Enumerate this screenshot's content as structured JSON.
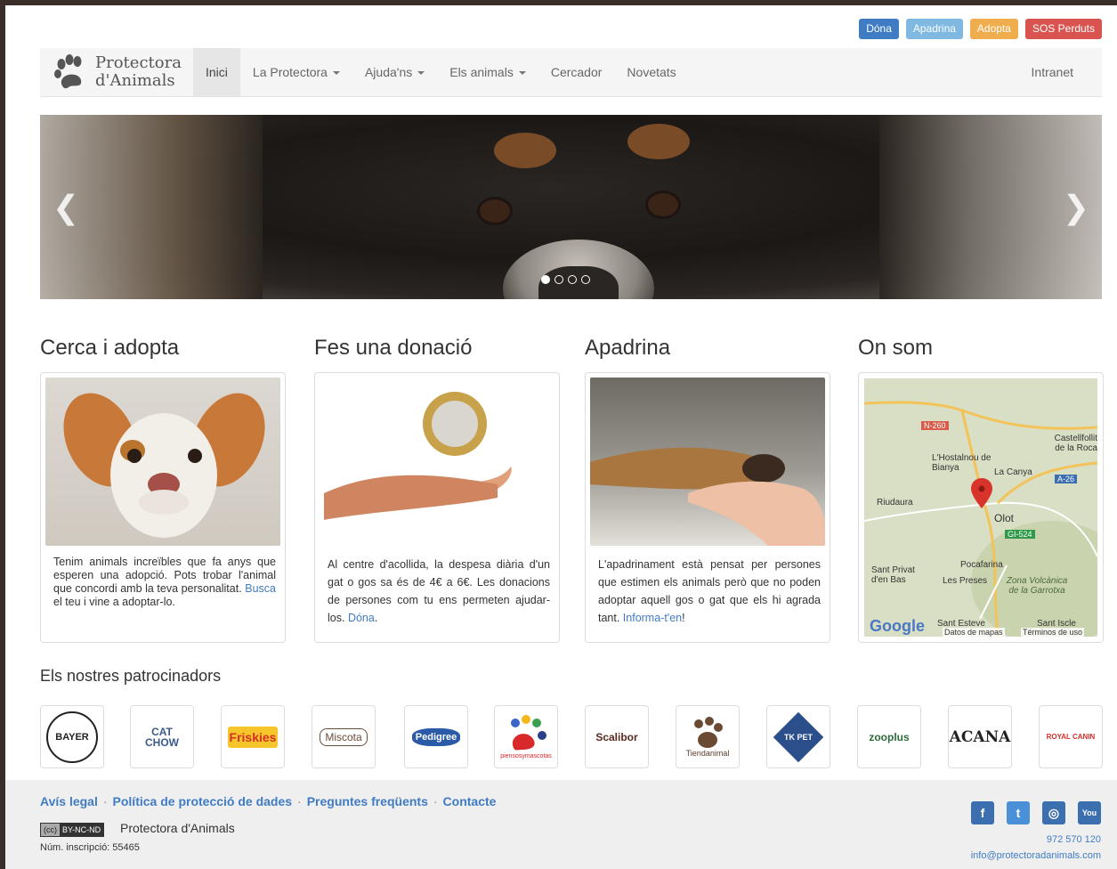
{
  "top_actions": [
    {
      "label": "Dóna",
      "style": "primary"
    },
    {
      "label": "Apadrina",
      "style": "info"
    },
    {
      "label": "Adopta",
      "style": "warning"
    },
    {
      "label": "SOS Perduts",
      "style": "danger"
    }
  ],
  "brand": {
    "line1": "Protectora",
    "line2": "d'Animals"
  },
  "nav": {
    "items": [
      {
        "label": "Inici",
        "active": true,
        "dropdown": false
      },
      {
        "label": "La Protectora",
        "dropdown": true
      },
      {
        "label": "Ajuda'ns",
        "dropdown": true
      },
      {
        "label": "Els animals",
        "dropdown": true
      },
      {
        "label": "Cercador",
        "dropdown": false
      },
      {
        "label": "Novetats",
        "dropdown": false
      }
    ],
    "right": "Intranet"
  },
  "carousel": {
    "slides": 4,
    "active_index": 0
  },
  "columns": [
    {
      "title": "Cerca i adopta",
      "text": "Tenim animals increïbles que fa anys que esperen una adopció. Pots trobar l'animal que concordi amb la teva personalitat. ",
      "link": "Busca",
      "text_after": " el teu i vine a adoptar-lo."
    },
    {
      "title": "Fes una donació",
      "text": "Al centre d'acollida, la despesa diària d'un gat o gos sa és de 4€ a 6€. Les donacions de persones com tu ens permeten ajudar-los. ",
      "link": "Dóna",
      "text_after": "."
    },
    {
      "title": "Apadrina",
      "text": "L'apadrinament està pensat per persones que estimen els animals però que no poden adoptar aquell gos o gat que els hi agrada tant. ",
      "link": "Informa-t'en",
      "text_after": "!"
    },
    {
      "title": "On som"
    }
  ],
  "map": {
    "labels": [
      "N-260",
      "Castellfollit de la Roca",
      "L'Hostalnou de Bianya",
      "La Canya",
      "A-26",
      "Riudaura",
      "Olot",
      "GI-524",
      "Sant Privat d'en Bas",
      "Pocafarina",
      "Les Preses",
      "Zona Volcànica de la Garrotxa",
      "Sant Esteve",
      "Sant Iscle"
    ],
    "google": "Google",
    "attribution": "Datos de mapas",
    "terms": "Términos de uso"
  },
  "sponsors_title": "Els nostres patrocinadors",
  "sponsors": [
    "BAYER",
    "CAT CHOW",
    "Friskies",
    "Miscota",
    "Pedigree",
    "piensosymascotas",
    "Scalibor",
    "Tiendanimal",
    "TK PET",
    "zooplus",
    "ACANA",
    "ROYAL CANIN"
  ],
  "footer": {
    "links": [
      "Avís legal",
      "Política de protecció de dades",
      "Preguntes freqüents",
      "Contacte"
    ],
    "cc": "BY-NC-ND",
    "org": "Protectora d'Animals",
    "registration": "Núm. inscripció: 55465",
    "phone": "972 570 120",
    "email": "info@protectoradanimals.com",
    "social": [
      "facebook",
      "twitter",
      "instagram",
      "youtube"
    ]
  }
}
